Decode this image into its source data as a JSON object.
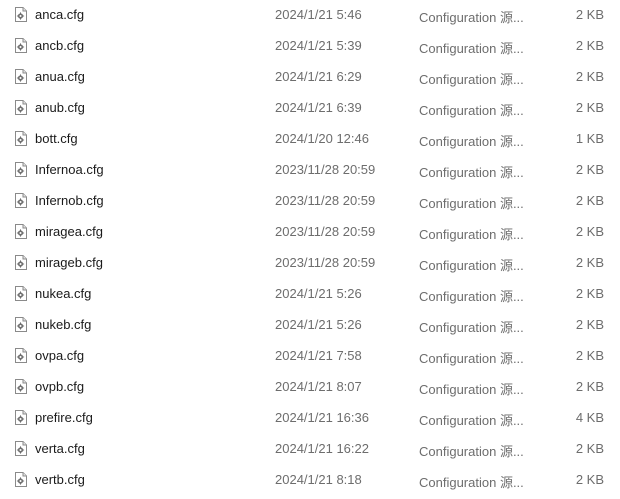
{
  "file_icon": "config-file-icon",
  "files": [
    {
      "name": "anca.cfg",
      "modified": "2024/1/21 5:46",
      "type": "Configuration 源...",
      "size": "2 KB"
    },
    {
      "name": "ancb.cfg",
      "modified": "2024/1/21 5:39",
      "type": "Configuration 源...",
      "size": "2 KB"
    },
    {
      "name": "anua.cfg",
      "modified": "2024/1/21 6:29",
      "type": "Configuration 源...",
      "size": "2 KB"
    },
    {
      "name": "anub.cfg",
      "modified": "2024/1/21 6:39",
      "type": "Configuration 源...",
      "size": "2 KB"
    },
    {
      "name": "bott.cfg",
      "modified": "2024/1/20 12:46",
      "type": "Configuration 源...",
      "size": "1 KB"
    },
    {
      "name": "Infernoa.cfg",
      "modified": "2023/11/28 20:59",
      "type": "Configuration 源...",
      "size": "2 KB"
    },
    {
      "name": "Infernob.cfg",
      "modified": "2023/11/28 20:59",
      "type": "Configuration 源...",
      "size": "2 KB"
    },
    {
      "name": "miragea.cfg",
      "modified": "2023/11/28 20:59",
      "type": "Configuration 源...",
      "size": "2 KB"
    },
    {
      "name": "mirageb.cfg",
      "modified": "2023/11/28 20:59",
      "type": "Configuration 源...",
      "size": "2 KB"
    },
    {
      "name": "nukea.cfg",
      "modified": "2024/1/21 5:26",
      "type": "Configuration 源...",
      "size": "2 KB"
    },
    {
      "name": "nukeb.cfg",
      "modified": "2024/1/21 5:26",
      "type": "Configuration 源...",
      "size": "2 KB"
    },
    {
      "name": "ovpa.cfg",
      "modified": "2024/1/21 7:58",
      "type": "Configuration 源...",
      "size": "2 KB"
    },
    {
      "name": "ovpb.cfg",
      "modified": "2024/1/21 8:07",
      "type": "Configuration 源...",
      "size": "2 KB"
    },
    {
      "name": "prefire.cfg",
      "modified": "2024/1/21 16:36",
      "type": "Configuration 源...",
      "size": "4 KB"
    },
    {
      "name": "verta.cfg",
      "modified": "2024/1/21 16:22",
      "type": "Configuration 源...",
      "size": "2 KB"
    },
    {
      "name": "vertb.cfg",
      "modified": "2024/1/21 8:18",
      "type": "Configuration 源...",
      "size": "2 KB"
    }
  ]
}
